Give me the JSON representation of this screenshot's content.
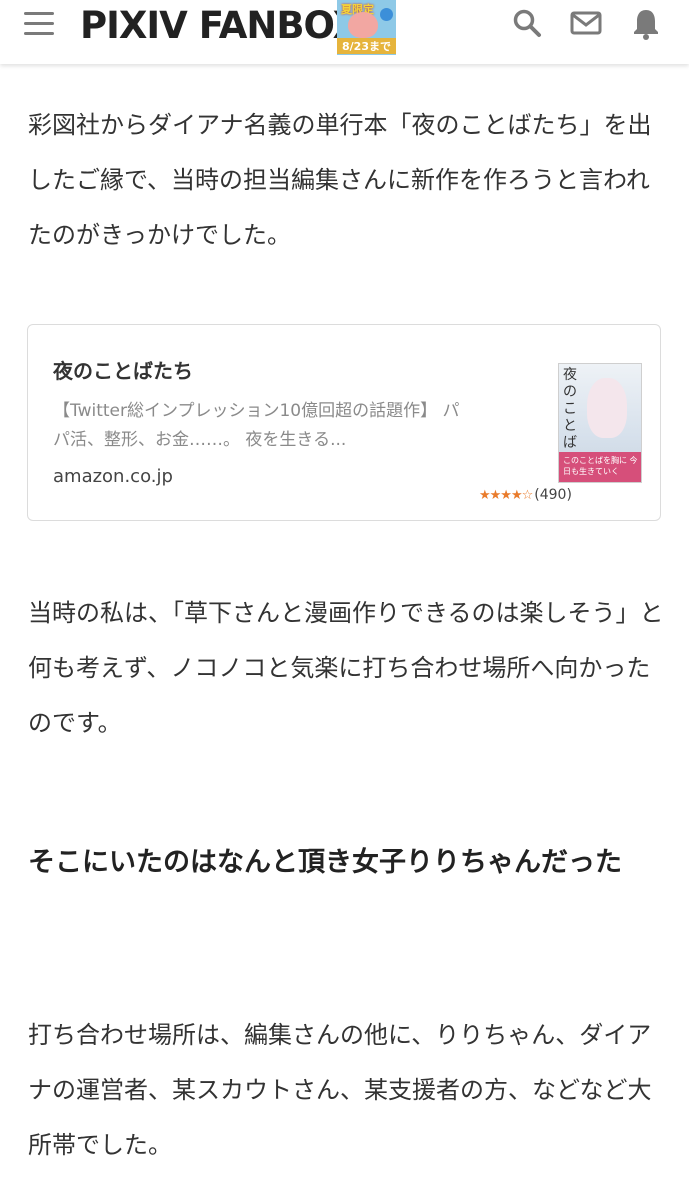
{
  "header": {
    "logo": "PIXIV FANBOX",
    "promo": {
      "top_text": "夏限定",
      "date_text": "8/23まで"
    },
    "icons": [
      "menu-icon",
      "search-icon",
      "mail-icon",
      "bell-icon"
    ]
  },
  "article": {
    "paragraph1": "彩図社からダイアナ名義の単行本「夜のことばたち」を出したご縁で、当時の担当編集さんに新作を作ろうと言われたのがきっかけでした。",
    "card": {
      "title": "夜のことばたち",
      "description": "【Twitter総インプレッション10億回超の話題作】 パパ活、整形、お金……。 夜を生きる...",
      "domain": "amazon.co.jp",
      "rating_stars": 4.5,
      "rating_count": "(490)",
      "cover_title": "夜のことばたち",
      "cover_band": "このことばを胸に 今日も生きていく"
    },
    "paragraph2": "当時の私は、「草下さんと漫画作りできるのは楽しそう」と何も考えず、ノコノコと気楽に打ち合わせ場所へ向かったのです。",
    "heading": "そこにいたのはなんと頂き女子りりちゃんだった",
    "paragraph3": "打ち合わせ場所は、編集さんの他に、りりちゃん、ダイアナの運営者、某スカウトさん、某支援者の方、などなど大所帯でした。"
  },
  "colors": {
    "text": "#333333",
    "star": "#e97b2b",
    "icon": "#7a7a7a",
    "cover_band": "#d64f7a"
  }
}
